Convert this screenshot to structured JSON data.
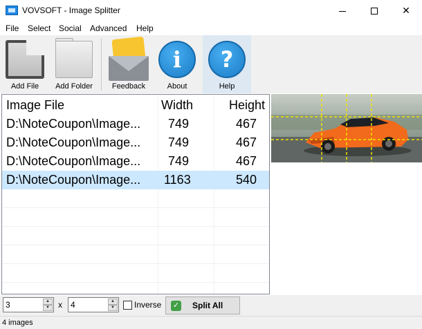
{
  "window": {
    "title": "VOVSOFT - Image Splitter",
    "minimize": "",
    "maximize": "",
    "close": "✕"
  },
  "menu": [
    "File",
    "Select",
    "Social",
    "Advanced",
    "Help"
  ],
  "toolbar": [
    {
      "label": "Add File",
      "icon": "add-file-icon"
    },
    {
      "label": "Add Folder",
      "icon": "folder-icon"
    },
    {
      "label": "Feedback",
      "icon": "feedback-envelope-icon"
    },
    {
      "label": "About",
      "icon": "info-icon",
      "glyph": "i"
    },
    {
      "label": "Help",
      "icon": "help-icon",
      "glyph": "?"
    }
  ],
  "list": {
    "columns": [
      "Image File",
      "Width",
      "Height"
    ],
    "rows": [
      {
        "file": "D:\\NoteCoupon\\Image...",
        "width": "749",
        "height": "467",
        "selected": false
      },
      {
        "file": "D:\\NoteCoupon\\Image...",
        "width": "749",
        "height": "467",
        "selected": false
      },
      {
        "file": "D:\\NoteCoupon\\Image...",
        "width": "749",
        "height": "467",
        "selected": false
      },
      {
        "file": "D:\\NoteCoupon\\Image...",
        "width": "1163",
        "height": "540",
        "selected": true
      }
    ]
  },
  "controls": {
    "rows_value": "3",
    "cols_value": "4",
    "times": "x",
    "inverse_label": "Inverse",
    "inverse_checked": false,
    "split_label": "Split All"
  },
  "status": "4 images",
  "colors": {
    "selection": "#cce8ff",
    "accent": "#1a7cc8",
    "car": "#f26a1b",
    "grid_lines": "#f5e300"
  }
}
